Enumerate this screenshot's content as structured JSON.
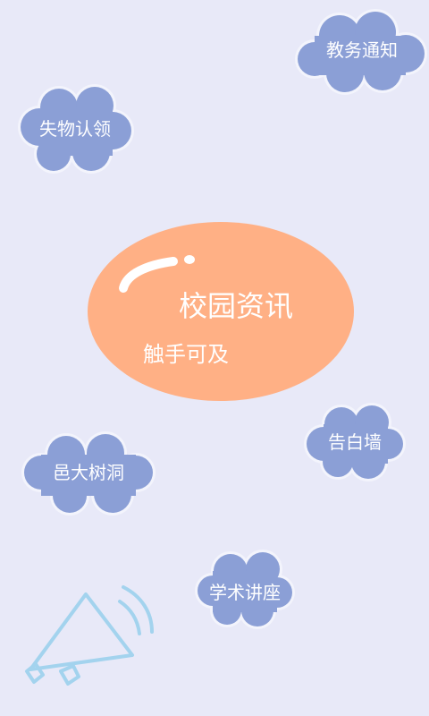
{
  "colors": {
    "background": "#e8e9f8",
    "cloud": "#8b9fd6",
    "cloud_outline": "#f3f4fc",
    "hero": "#ffb085",
    "icon_stroke": "#a3d3ee"
  },
  "hero": {
    "title": "校园资讯",
    "subtitle": "触手可及"
  },
  "menu": {
    "academic_notice": "教务通知",
    "lost_and_found": "失物认领",
    "notice_wall": "告白墙",
    "tree_hole": "邑大树洞",
    "lectures": "学术讲座"
  },
  "icons": {
    "megaphone": "megaphone-icon",
    "hero_shine": "shine-highlight"
  }
}
